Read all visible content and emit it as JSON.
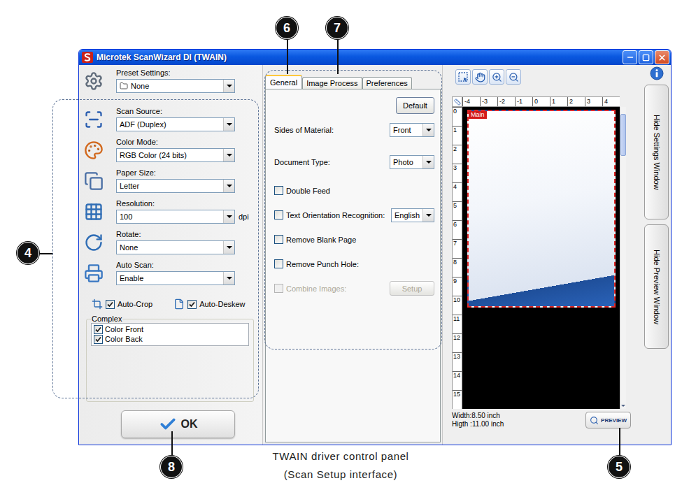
{
  "window": {
    "title": "Microtek ScanWizard DI (TWAIN)"
  },
  "settings": {
    "preset": {
      "label": "Preset Settings:",
      "value": "None"
    },
    "fields": [
      {
        "label": "Scan Source:",
        "value": "ADF (Duplex)",
        "unit": ""
      },
      {
        "label": "Color Mode:",
        "value": "RGB Color (24 bits)",
        "unit": ""
      },
      {
        "label": "Paper Size:",
        "value": "Letter",
        "unit": ""
      },
      {
        "label": "Resolution:",
        "value": "100",
        "unit": "dpi"
      },
      {
        "label": "Rotate:",
        "value": "None",
        "unit": ""
      },
      {
        "label": "Auto Scan:",
        "value": "Enable",
        "unit": ""
      }
    ],
    "options": [
      {
        "label": "Auto-Crop",
        "checked": true
      },
      {
        "label": "Auto-Deskew",
        "checked": true
      }
    ],
    "complex": {
      "title": "Complex",
      "items": [
        {
          "label": "Color Front",
          "checked": true
        },
        {
          "label": "Color Back",
          "checked": true
        }
      ]
    },
    "ok_button": "OK"
  },
  "tabs": [
    {
      "label": "General",
      "selected": true
    },
    {
      "label": "Image Process",
      "selected": false
    },
    {
      "label": "Preferences",
      "selected": false
    }
  ],
  "general": {
    "default_button": "Default",
    "rows": [
      {
        "kind": "select",
        "label": "Sides of Material:",
        "value": "Front"
      },
      {
        "kind": "select",
        "label": "Document Type:",
        "value": "Photo"
      },
      {
        "kind": "check",
        "label": "Double Feed",
        "checked": false,
        "disabled": false
      },
      {
        "kind": "check-select",
        "label": "Text Orientation Recognition:",
        "value": "English",
        "checked": false,
        "disabled": false
      },
      {
        "kind": "check",
        "label": "Remove Blank Page",
        "checked": false,
        "disabled": false
      },
      {
        "kind": "check",
        "label": "Remove Punch Hole:",
        "checked": false,
        "disabled": false
      },
      {
        "kind": "check-button",
        "label": "Combine Images:",
        "button": "Setup",
        "checked": false,
        "disabled": true
      }
    ]
  },
  "preview": {
    "h_ruler": [
      "-4",
      "-3",
      "-2",
      "-1",
      "0",
      "1",
      "2",
      "3",
      "4"
    ],
    "v_ruler": [
      "0",
      "1",
      "2",
      "3",
      "4",
      "5",
      "6",
      "7",
      "8",
      "9",
      "10",
      "11",
      "12",
      "13",
      "14",
      "15"
    ],
    "frame_label": "Main",
    "size_lines": [
      "Width:8.50 inch",
      "Higth :11.00 inch"
    ],
    "button": "PREVIEW"
  },
  "side_buttons": [
    "Hide Settings Window",
    "Hide Preview Window"
  ],
  "callouts": {
    "settings": "4",
    "preview_button": "5",
    "general_tab": "6",
    "image_process_tab": "7",
    "ok_button": "8"
  },
  "caption": [
    "TWAIN driver control panel",
    "(Scan Setup interface)"
  ]
}
